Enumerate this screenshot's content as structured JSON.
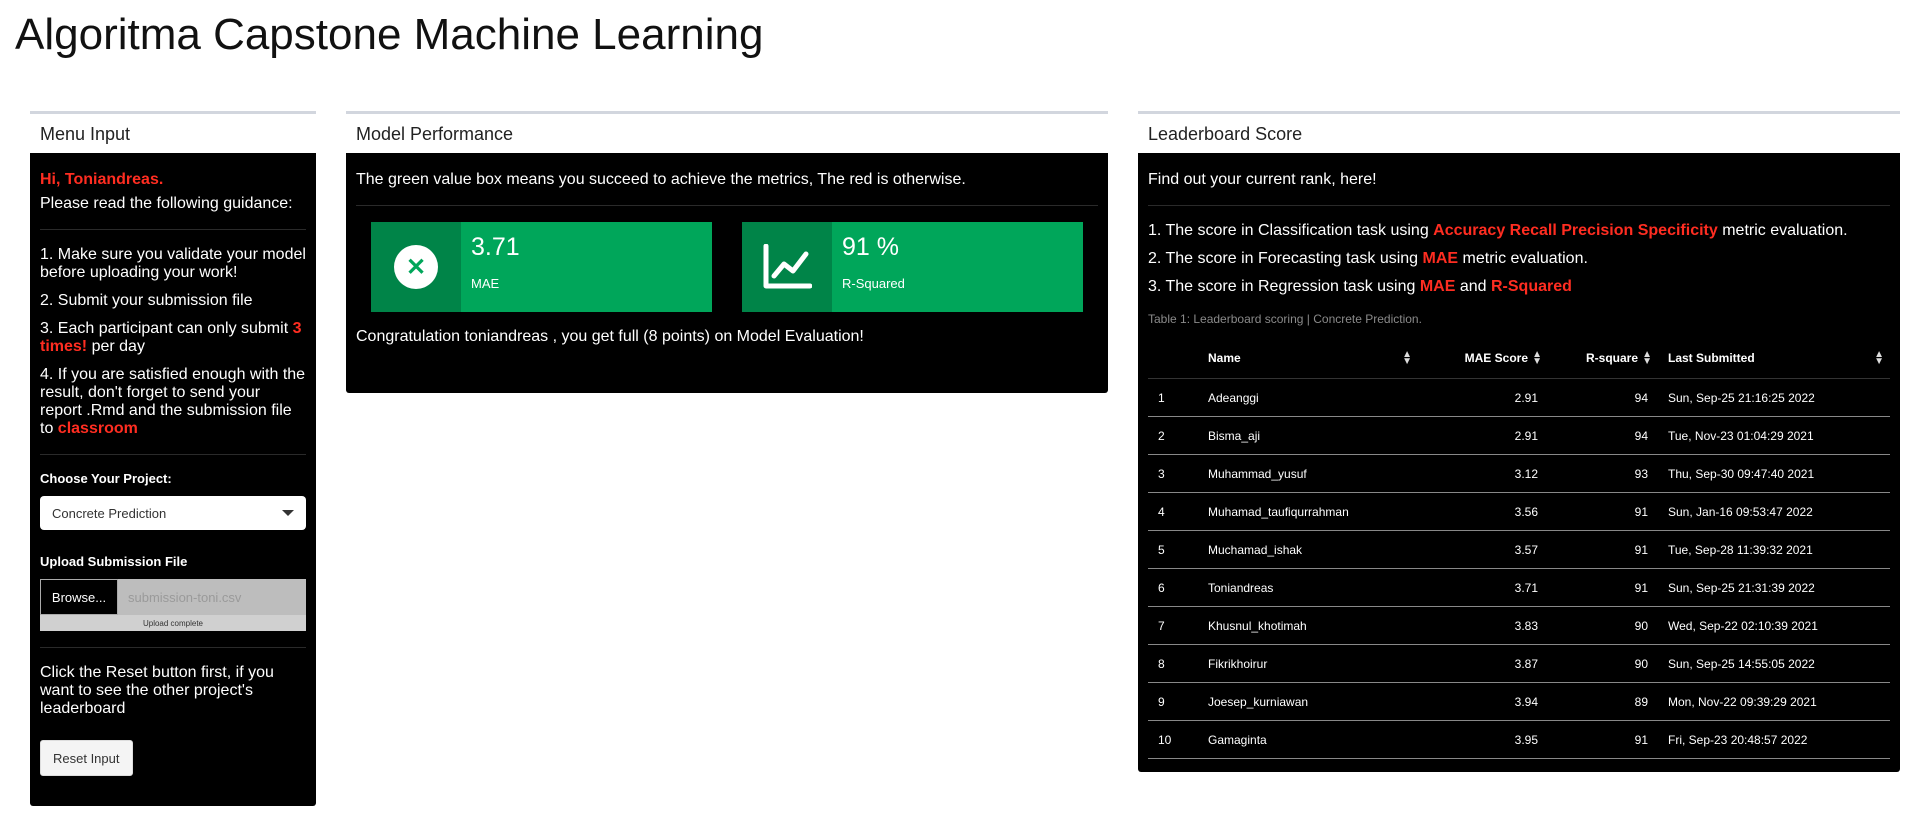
{
  "app": {
    "title": "Algoritma Capstone Machine Learning"
  },
  "menu": {
    "header": "Menu Input",
    "greeting": "Hi, Toniandreas.",
    "read_guidance": "Please read the following guidance:",
    "guide1": "1. Make sure you validate your model before uploading your work!",
    "guide2": "2. Submit your submission file",
    "guide3_pre": "3. Each participant can only submit ",
    "guide3_red": "3 times!",
    "guide3_post": " per day",
    "guide4_pre": "4. If you are satisfied enough with the result, don't forget to send your report .Rmd and the submission file to ",
    "guide4_red": "classroom",
    "project_label": "Choose Your Project:",
    "project_value": "Concrete Prediction",
    "upload_label": "Upload Submission File",
    "browse_label": "Browse...",
    "file_name": "submission-toni.csv",
    "upload_status": "Upload complete",
    "reset_text": "Click the Reset button first, if you want to see the other project's leaderboard",
    "reset_button": "Reset Input"
  },
  "performance": {
    "header": "Model Performance",
    "note": "The green value box means you succeed to achieve the metrics, The red is otherwise.",
    "box1": {
      "value": "3.71",
      "label": "MAE"
    },
    "box2": {
      "value": "91 %",
      "label": "R-Squared"
    },
    "congrats": "Congratulation toniandreas , you get full (8 points) on Model Evaluation!",
    "colors": {
      "success": "#00a65a"
    }
  },
  "leaderboard": {
    "header": "Leaderboard Score",
    "intro": "Find out your current rank, here!",
    "line1_pre": "1. The score in Classification task using ",
    "line1_red": "Accuracy Recall Precision Specificity",
    "line1_post": " metric evaluation.",
    "line2_pre": "2. The score in Forecasting task using ",
    "line2_red": "MAE",
    "line2_post": " metric evaluation.",
    "line3_pre": "3. The score in Regression task using ",
    "line3_red1": "MAE",
    "line3_mid": " and ",
    "line3_red2": "R-Squared",
    "caption": "Table 1: Leaderboard scoring | Concrete Prediction.",
    "columns": {
      "name": "Name",
      "mae": "MAE Score",
      "r2": "R-square",
      "submitted": "Last Submitted"
    },
    "rows": [
      [
        "1",
        "Adeanggi",
        "2.91",
        "94",
        "Sun, Sep-25 21:16:25 2022"
      ],
      [
        "2",
        "Bisma_aji",
        "2.91",
        "94",
        "Tue, Nov-23 01:04:29 2021"
      ],
      [
        "3",
        "Muhammad_yusuf",
        "3.12",
        "93",
        "Thu, Sep-30 09:47:40 2021"
      ],
      [
        "4",
        "Muhamad_taufiqurrahman",
        "3.56",
        "91",
        "Sun, Jan-16 09:53:47 2022"
      ],
      [
        "5",
        "Muchamad_ishak",
        "3.57",
        "91",
        "Tue, Sep-28 11:39:32 2021"
      ],
      [
        "6",
        "Toniandreas",
        "3.71",
        "91",
        "Sun, Sep-25 21:31:39 2022"
      ],
      [
        "7",
        "Khusnul_khotimah",
        "3.83",
        "90",
        "Wed, Sep-22 02:10:39 2021"
      ],
      [
        "8",
        "Fikrikhoirur",
        "3.87",
        "90",
        "Sun, Sep-25 14:55:05 2022"
      ],
      [
        "9",
        "Joesep_kurniawan",
        "3.94",
        "89",
        "Mon, Nov-22 09:39:29 2021"
      ],
      [
        "10",
        "Gamaginta",
        "3.95",
        "91",
        "Fri, Sep-23 20:48:57 2022"
      ]
    ]
  }
}
